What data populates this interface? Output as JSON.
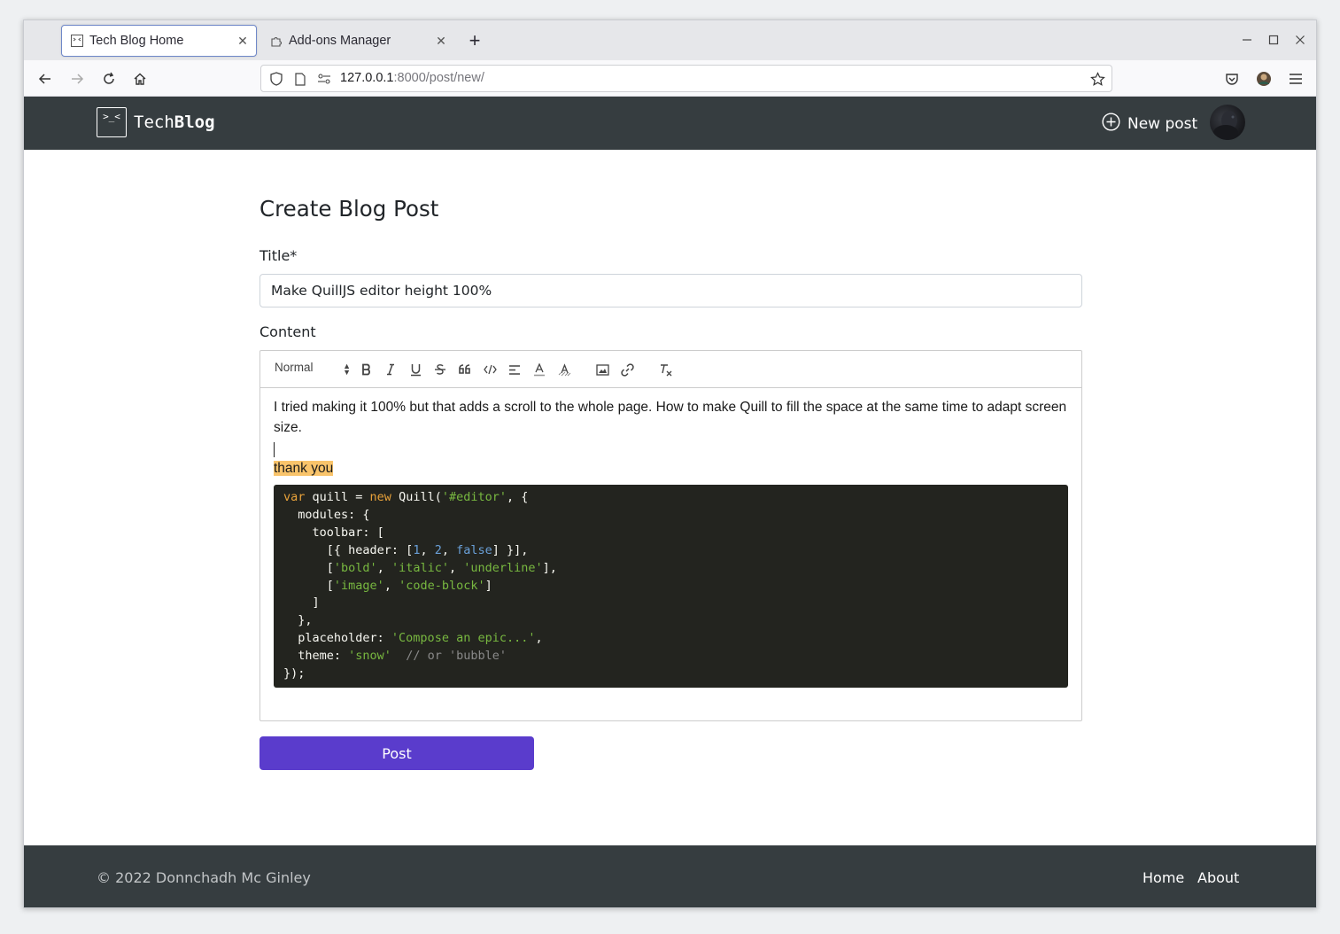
{
  "browser": {
    "tabs": [
      {
        "label": "Tech Blog Home",
        "active": true,
        "icon": "terminal-favicon-icon"
      },
      {
        "label": "Add-ons Manager",
        "active": false,
        "icon": "puzzle-icon"
      }
    ],
    "url_host": "127.0.0.1",
    "url_rest": ":8000/post/new/"
  },
  "site": {
    "logo_text": ">_<",
    "brand_prefix": "Tech",
    "brand_suffix": "Blog",
    "new_post_label": "New post"
  },
  "form": {
    "heading": "Create Blog Post",
    "title_label": "Title*",
    "title_value": "Make QuillJS editor height 100%",
    "content_label": "Content",
    "header_select": "Normal",
    "submit_label": "Post"
  },
  "editor": {
    "paragraph": "I tried making it 100% but that adds a scroll to the whole page. How to make Quill to fill the space at the same time to adapt screen size.",
    "highlighted": "thank you",
    "code_lines": [
      "var quill = new Quill('#editor', {",
      "  modules: {",
      "    toolbar: [",
      "      [{ header: [1, 2, false] }],",
      "      ['bold', 'italic', 'underline'],",
      "      ['image', 'code-block']",
      "    ]",
      "  },",
      "  placeholder: 'Compose an epic...',",
      "  theme: 'snow'  // or 'bubble'",
      "});"
    ]
  },
  "footer": {
    "copyright": "© 2022 Donnchadh Mc Ginley",
    "links": [
      "Home",
      "About"
    ]
  },
  "colors": {
    "header_bg": "#363d40",
    "accent": "#5a3ccc",
    "code_bg": "#23241f",
    "highlight": "#f9c46b"
  }
}
